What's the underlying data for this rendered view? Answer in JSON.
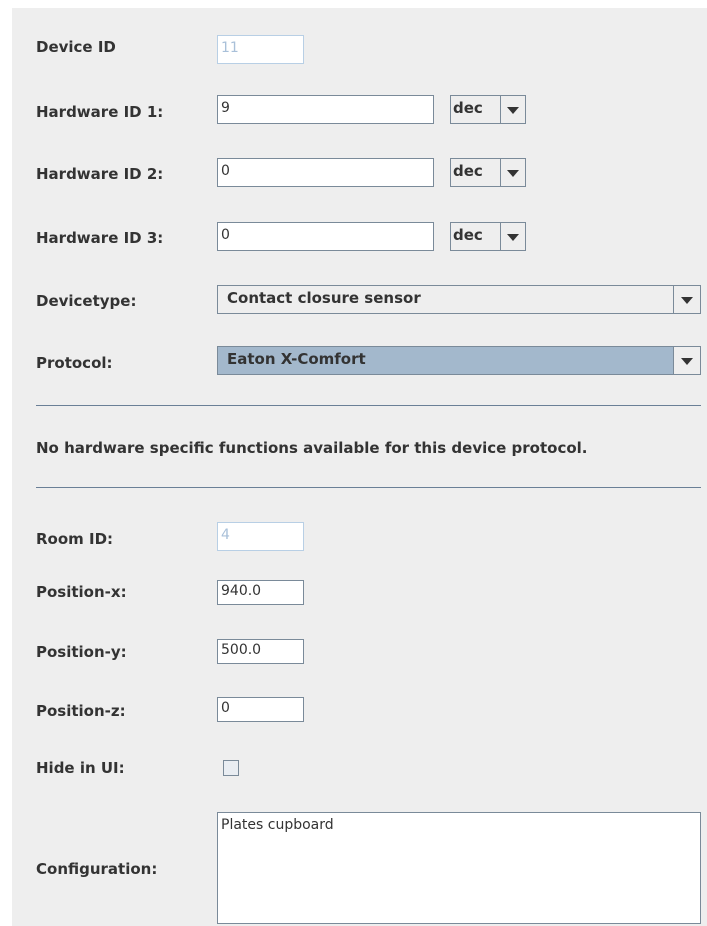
{
  "form": {
    "device_id": {
      "label": "Device ID",
      "value": "11"
    },
    "hardware_ids": [
      {
        "label": "Hardware ID 1:",
        "value": "9",
        "format": "dec"
      },
      {
        "label": "Hardware ID 2:",
        "value": "0",
        "format": "dec"
      },
      {
        "label": "Hardware ID 3:",
        "value": "0",
        "format": "dec"
      }
    ],
    "devicetype": {
      "label": "Devicetype:",
      "value": "Contact closure sensor"
    },
    "protocol": {
      "label": "Protocol:",
      "value": "Eaton X-Comfort"
    },
    "note": "No hardware specific functions available for this device protocol.",
    "room_id": {
      "label": "Room ID:",
      "value": "4"
    },
    "position_x": {
      "label": "Position-x:",
      "value": "940.0"
    },
    "position_y": {
      "label": "Position-y:",
      "value": "500.0"
    },
    "position_z": {
      "label": "Position-z:",
      "value": "0"
    },
    "hide_in_ui": {
      "label": "Hide in UI:",
      "checked": false
    },
    "configuration": {
      "label": "Configuration:",
      "value": "Plates cupboard"
    }
  },
  "icons": {
    "dropdown": "chevron-down-icon"
  },
  "colors": {
    "background": "#eeeeee",
    "selected_combo": "#a3b8cc",
    "disabled_text": "#a9c0d9",
    "separator": "#6a7f96"
  }
}
